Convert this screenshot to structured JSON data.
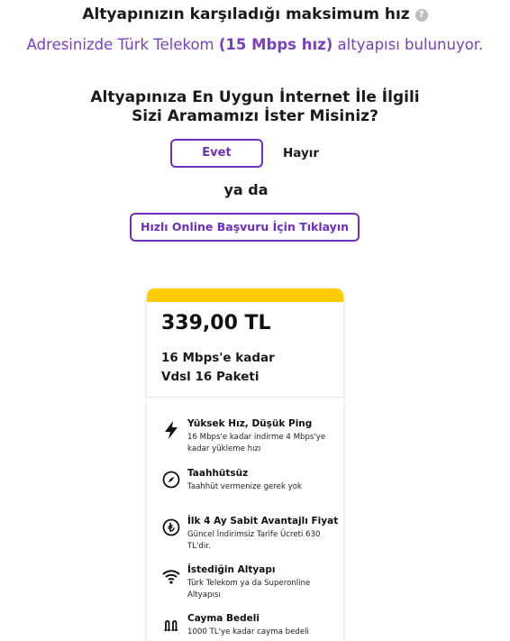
{
  "infrastructure": {
    "title": "Altyapınızın karşıladığı maksimum hız",
    "help_icon": "question-icon",
    "address_prefix": "Adresinizde Türk Telekom ",
    "speed_highlight": "(15 Mbps hız)",
    "address_suffix": " altyapısı bulunuyor."
  },
  "callback": {
    "question": "Altyapınıza En Uygun İnternet İle İlgili Sizi Aramamızı İster Misiniz?",
    "yes_label": "Evet",
    "no_label": "Hayır",
    "or_label": "ya da",
    "quick_apply_label": "Hızlı Online Başvuru İçin Tıklayın"
  },
  "package": {
    "accent_color": "#ffcc00",
    "price": "339,00 TL",
    "speed_line": "16 Mbps'e kadar",
    "name_line": "Vdsl 16 Paketi",
    "features": [
      {
        "icon": "lightning-icon",
        "title": "Yüksek Hız, Düşük Ping",
        "desc": "16 Mbps'e kadar indirme 4 Mbps'ye kadar yükleme hızı"
      },
      {
        "icon": "compass-icon",
        "title": "Taahhütsüz",
        "desc": "Taahhüt vermenize gerek yok"
      },
      {
        "icon": "lira-icon",
        "title": "İlk 4 Ay Sabit Avantajlı Fiyat",
        "desc": "Güncel İndirimsiz Tarife Ücreti 630 TL'dir."
      },
      {
        "icon": "wifi-icon",
        "title": "İstediğin Altyapı",
        "desc": "Türk Telekom ya da Superonline Altyapısı"
      },
      {
        "icon": "cancellation-icon",
        "title": "Cayma Bedeli",
        "desc": "1000 TL'ye kadar cayma bedeli"
      }
    ]
  },
  "colors": {
    "brand_purple": "#6e2fc2",
    "text_purple": "#7b3fc4",
    "yellow": "#ffcc00"
  }
}
